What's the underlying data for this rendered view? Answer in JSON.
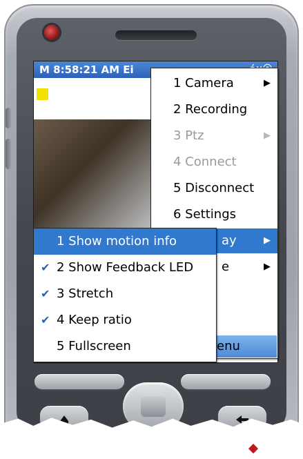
{
  "status_bar": {
    "time_text": "M 8:58:21 AM Ei",
    "status_icons": "é×⦿"
  },
  "camera_view": {
    "led_color": "#f2e200"
  },
  "main_menu": {
    "items": [
      {
        "label": "1 Camera",
        "has_submenu": true,
        "enabled": true
      },
      {
        "label": "2 Recording",
        "has_submenu": false,
        "enabled": true
      },
      {
        "label": "3 Ptz",
        "has_submenu": true,
        "enabled": false
      },
      {
        "label": "4 Connect",
        "has_submenu": false,
        "enabled": false
      },
      {
        "label": "5 Disconnect",
        "has_submenu": false,
        "enabled": true
      },
      {
        "label": "6 Settings",
        "has_submenu": false,
        "enabled": true
      },
      {
        "label": "ay",
        "has_submenu": true,
        "enabled": true,
        "selected": true
      },
      {
        "label": "e",
        "has_submenu": true,
        "enabled": true
      }
    ],
    "submenu_arrow": "▶"
  },
  "display_submenu": {
    "check_glyph": "✔",
    "items": [
      {
        "label": "1 Show motion info",
        "checked": false,
        "selected": true
      },
      {
        "label": "2 Show Feedback LED",
        "checked": true,
        "selected": false
      },
      {
        "label": "3 Stretch",
        "checked": true,
        "selected": false
      },
      {
        "label": "4 Keep ratio",
        "checked": true,
        "selected": false
      },
      {
        "label": "5 Fullscreen",
        "checked": false,
        "selected": false
      }
    ]
  },
  "softkey_bar": {
    "right_label": "enu"
  },
  "colors": {
    "selection": "#3079cf",
    "titlebar": "#2c62b8",
    "disabled_text": "#9a9a9a"
  },
  "icons": {
    "home_key": "home-icon",
    "back_key": "back-icon"
  }
}
